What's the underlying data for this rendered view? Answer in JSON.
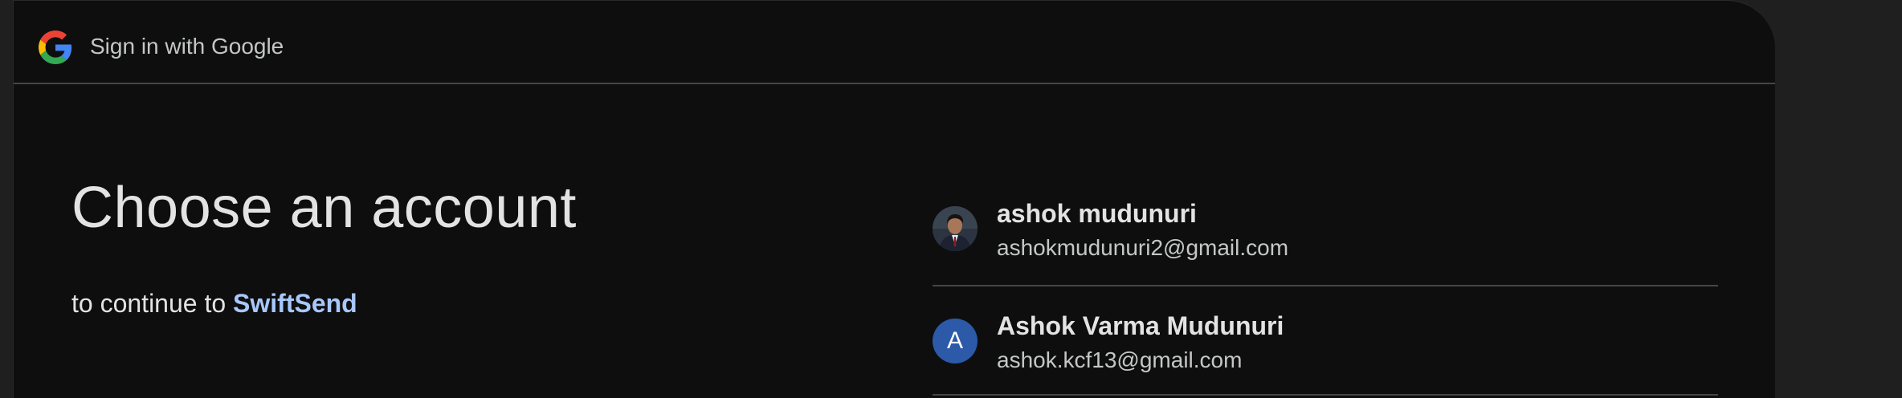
{
  "header": {
    "title": "Sign in with Google"
  },
  "main": {
    "title": "Choose an account",
    "subtitle_prefix": "to continue to",
    "app_name": "SwiftSend"
  },
  "accounts": [
    {
      "name": "ashok mudunuri",
      "email": "ashokmudunuri2@gmail.com",
      "avatar": "profile-photo"
    },
    {
      "name": "Ashok Varma Mudunuri",
      "email": "ashok.kcf13@gmail.com",
      "avatar_letter": "A",
      "avatar_color": "#2c5aa8"
    }
  ],
  "colors": {
    "background": "#0e0e0f",
    "link": "#a8c7fa",
    "divider": "#444746"
  }
}
